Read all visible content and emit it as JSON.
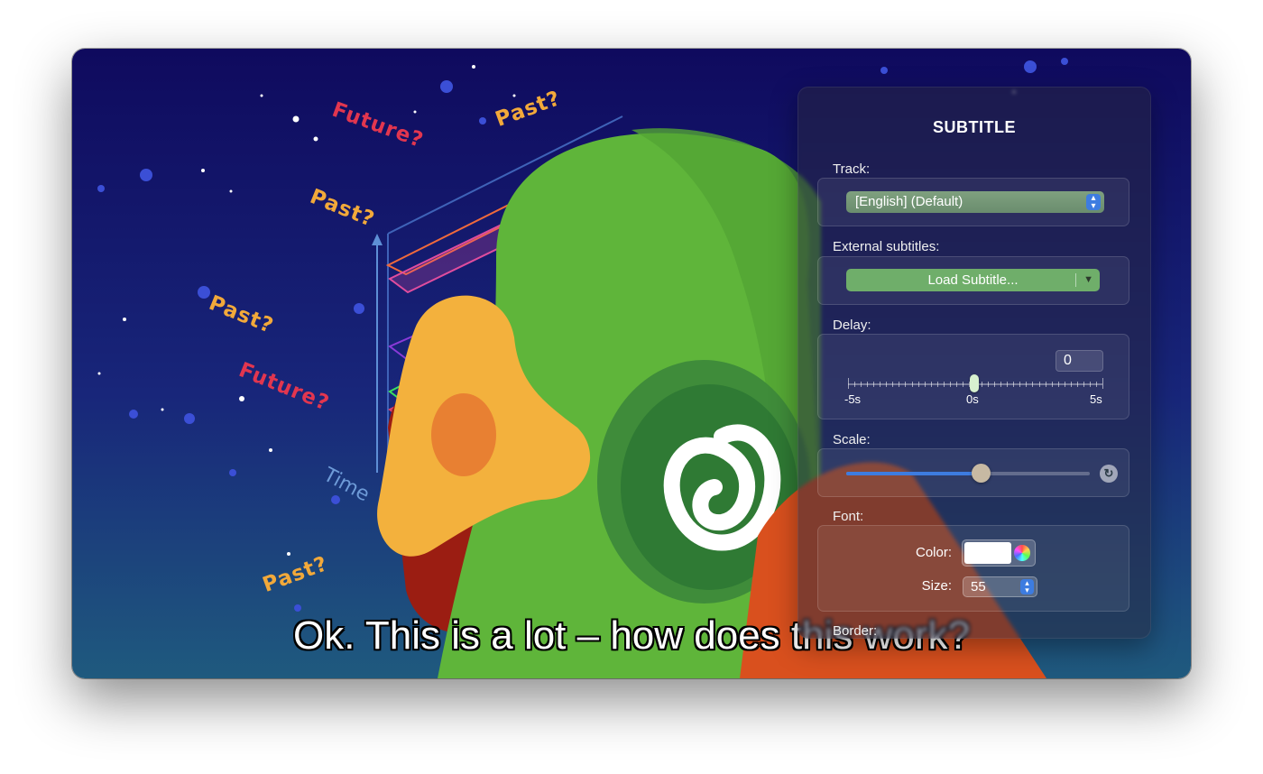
{
  "scene": {
    "words": [
      {
        "text": "Future?",
        "kind": "future"
      },
      {
        "text": "Past?",
        "kind": "past"
      },
      {
        "text": "Past?",
        "kind": "past"
      },
      {
        "text": "Past?",
        "kind": "past"
      },
      {
        "text": "Future?",
        "kind": "future"
      },
      {
        "text": "Past?",
        "kind": "past"
      }
    ],
    "time_label": "Time"
  },
  "caption": "Ok. This is a lot – how does this work?",
  "panel": {
    "title": "SUBTITLE",
    "track": {
      "label": "Track:",
      "value": "[English] (Default)"
    },
    "external": {
      "label": "External subtitles:",
      "button": "Load Subtitle..."
    },
    "delay": {
      "label": "Delay:",
      "value": "0",
      "min_label": "-5s",
      "mid_label": "0s",
      "max_label": "5s",
      "current": 0,
      "range": [
        -5,
        5
      ]
    },
    "scale": {
      "label": "Scale:",
      "fraction": 0.55
    },
    "font": {
      "label": "Font:",
      "color_label": "Color:",
      "color_value": "#ffffff",
      "size_label": "Size:",
      "size_value": "55"
    },
    "border": {
      "label": "Border:"
    }
  },
  "colors": {
    "accent": "#3d7ce0",
    "past": "#f2a93a",
    "future": "#e2364f"
  },
  "icons": {
    "popup": "up-down-chevron-icon",
    "load": "chevron-down-icon",
    "reset": "reset-icon",
    "color_wheel": "color-wheel-icon"
  }
}
